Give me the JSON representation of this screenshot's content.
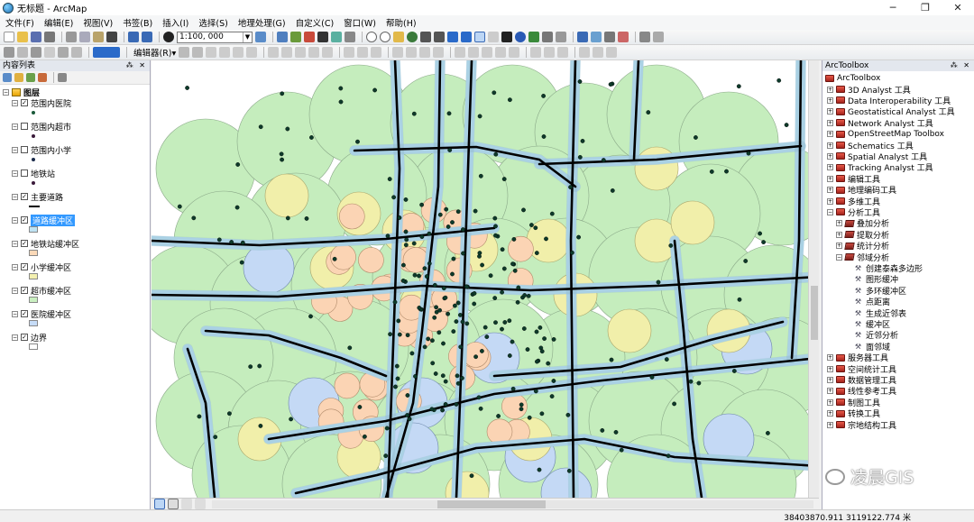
{
  "window": {
    "title": "无标题 - ArcMap",
    "minimize": "─",
    "maximize": "❐",
    "close": "✕"
  },
  "menu": [
    "文件(F)",
    "编辑(E)",
    "视图(V)",
    "书签(B)",
    "插入(I)",
    "选择(S)",
    "地理处理(G)",
    "自定义(C)",
    "窗口(W)",
    "帮助(H)"
  ],
  "toolbar": {
    "scale": "1:100, 000",
    "editor": "编辑器(R)▾"
  },
  "toc": {
    "title": "内容列表",
    "root": "图层",
    "layers": [
      {
        "name": "范围内医院",
        "checked": true,
        "symbol": "dot",
        "color": "#1a5a3a"
      },
      {
        "name": "范围内超市",
        "checked": false,
        "symbol": "dot",
        "color": "#3a1a3a"
      },
      {
        "name": "范围内小学",
        "checked": false,
        "symbol": "dot",
        "color": "#1a2a4a"
      },
      {
        "name": "地铁站",
        "checked": false,
        "symbol": "dot",
        "color": "#3a1a3a"
      },
      {
        "name": "主要道路",
        "checked": true,
        "symbol": "line",
        "color": "#000000"
      },
      {
        "name": "道路缓冲区",
        "checked": true,
        "symbol": "box",
        "color": "#bfe3f3",
        "selected": true
      },
      {
        "name": "地铁站缓冲区",
        "checked": true,
        "symbol": "box",
        "color": "#fbd9b8"
      },
      {
        "name": "小学缓冲区",
        "checked": true,
        "symbol": "box",
        "color": "#f3f0b0"
      },
      {
        "name": "超市缓冲区",
        "checked": true,
        "symbol": "box",
        "color": "#c9efc0"
      },
      {
        "name": "医院缓冲区",
        "checked": true,
        "symbol": "box",
        "color": "#c6dcf7"
      },
      {
        "name": "边界",
        "checked": true,
        "symbol": "box",
        "color": "#ffffff"
      }
    ]
  },
  "arctoolbox": {
    "title": "ArcToolbox",
    "root": "ArcToolbox",
    "items": [
      {
        "label": "3D Analyst 工具",
        "level": 0,
        "kind": "toolbox",
        "expanded": false
      },
      {
        "label": "Data Interoperability 工具",
        "level": 0,
        "kind": "toolbox",
        "expanded": false
      },
      {
        "label": "Geostatistical Analyst 工具",
        "level": 0,
        "kind": "toolbox",
        "expanded": false
      },
      {
        "label": "Network Analyst 工具",
        "level": 0,
        "kind": "toolbox",
        "expanded": false
      },
      {
        "label": "OpenStreetMap Toolbox",
        "level": 0,
        "kind": "toolbox",
        "expanded": false
      },
      {
        "label": "Schematics 工具",
        "level": 0,
        "kind": "toolbox",
        "expanded": false
      },
      {
        "label": "Spatial Analyst 工具",
        "level": 0,
        "kind": "toolbox",
        "expanded": false
      },
      {
        "label": "Tracking Analyst 工具",
        "level": 0,
        "kind": "toolbox",
        "expanded": false
      },
      {
        "label": "编辑工具",
        "level": 0,
        "kind": "toolbox",
        "expanded": false
      },
      {
        "label": "地理编码工具",
        "level": 0,
        "kind": "toolbox",
        "expanded": false
      },
      {
        "label": "多维工具",
        "level": 0,
        "kind": "toolbox",
        "expanded": false
      },
      {
        "label": "分析工具",
        "level": 0,
        "kind": "toolbox",
        "expanded": true
      },
      {
        "label": "叠加分析",
        "level": 1,
        "kind": "toolset",
        "expanded": false
      },
      {
        "label": "提取分析",
        "level": 1,
        "kind": "toolset",
        "expanded": false
      },
      {
        "label": "统计分析",
        "level": 1,
        "kind": "toolset",
        "expanded": false
      },
      {
        "label": "邻域分析",
        "level": 1,
        "kind": "toolset",
        "expanded": true
      },
      {
        "label": "创建泰森多边形",
        "level": 2,
        "kind": "tool"
      },
      {
        "label": "图形缓冲",
        "level": 2,
        "kind": "tool"
      },
      {
        "label": "多环缓冲区",
        "level": 2,
        "kind": "tool"
      },
      {
        "label": "点距离",
        "level": 2,
        "kind": "tool"
      },
      {
        "label": "生成近邻表",
        "level": 2,
        "kind": "tool"
      },
      {
        "label": "缓冲区",
        "level": 2,
        "kind": "tool"
      },
      {
        "label": "近邻分析",
        "level": 2,
        "kind": "tool"
      },
      {
        "label": "面邻域",
        "level": 2,
        "kind": "tool"
      },
      {
        "label": "服务器工具",
        "level": 0,
        "kind": "toolbox",
        "expanded": false
      },
      {
        "label": "空间统计工具",
        "level": 0,
        "kind": "toolbox",
        "expanded": false
      },
      {
        "label": "数据管理工具",
        "level": 0,
        "kind": "toolbox",
        "expanded": false
      },
      {
        "label": "线性参考工具",
        "level": 0,
        "kind": "toolbox",
        "expanded": false
      },
      {
        "label": "制图工具",
        "level": 0,
        "kind": "toolbox",
        "expanded": false
      },
      {
        "label": "转换工具",
        "level": 0,
        "kind": "toolbox",
        "expanded": false
      },
      {
        "label": "宗地结构工具",
        "level": 0,
        "kind": "toolbox",
        "expanded": false
      }
    ]
  },
  "watermark": "凌晨GIS",
  "status": {
    "coords": "38403870.911  3119122.774 米"
  },
  "colors": {
    "road_buffer": "#b8dff2",
    "subway_buffer": "#fbd4b4",
    "school_buffer": "#f1efaa",
    "market_buffer": "#c5edbd",
    "hospital_buffer": "#c4d9f5",
    "road": "#000000",
    "point": "#0d3a2a"
  }
}
